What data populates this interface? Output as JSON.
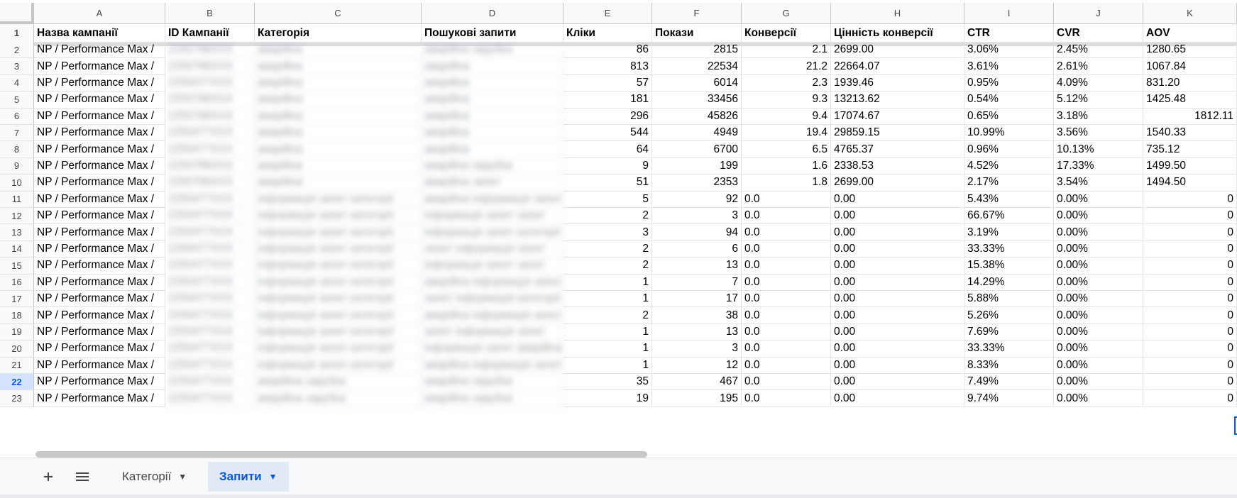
{
  "columns": [
    "",
    "A",
    "B",
    "C",
    "D",
    "E",
    "F",
    "G",
    "H",
    "I",
    "J",
    "K"
  ],
  "headers": [
    "Назва кампанії",
    "ID Кампанії",
    "Категорія",
    "Пошукові запити",
    "Кліки",
    "Покази",
    "Конверсії",
    "Цінність конверсії",
    "CTR",
    "CVR",
    "AOV"
  ],
  "rows": [
    {
      "n": "2",
      "c": [
        "NP / Performance Max /",
        "2250788XXX",
        "аварійна",
        "аварійна зарубка",
        "86",
        "2815",
        "2.1",
        "2699.00",
        "3.06%",
        "2.45%",
        "1280.65"
      ]
    },
    {
      "n": "3",
      "c": [
        "NP / Performance Max /",
        "2250788XXX",
        "аварійна",
        "аварійна",
        "813",
        "22534",
        "21.2",
        "22664.07",
        "3.61%",
        "2.61%",
        "1067.84"
      ]
    },
    {
      "n": "4",
      "c": [
        "NP / Performance Max /",
        "2250477XXX",
        "аварійна",
        "аварійна",
        "57",
        "6014",
        "2.3",
        "1939.46",
        "0.95%",
        "4.09%",
        "831.20"
      ]
    },
    {
      "n": "5",
      "c": [
        "NP / Performance Max /",
        "2250788XXX",
        "аварійна",
        "аварійна",
        "181",
        "33456",
        "9.3",
        "13213.62",
        "0.54%",
        "5.12%",
        "1425.48"
      ]
    },
    {
      "n": "6",
      "c": [
        "NP / Performance Max /",
        "2250788XXX",
        "аварійна",
        "аварійна",
        "296",
        "45826",
        "9.4",
        "17074.67",
        "0.65%",
        "3.18%",
        "1812.11"
      ]
    },
    {
      "n": "7",
      "c": [
        "NP / Performance Max /",
        "2250477XXX",
        "аварійна",
        "аварійна",
        "544",
        "4949",
        "19.4",
        "29859.15",
        "10.99%",
        "3.56%",
        "1540.33"
      ]
    },
    {
      "n": "8",
      "c": [
        "NP / Performance Max /",
        "2250477XXX",
        "аварійна",
        "аварійна",
        "64",
        "6700",
        "6.5",
        "4765.37",
        "0.96%",
        "10.13%",
        "735.12"
      ]
    },
    {
      "n": "9",
      "c": [
        "NP / Performance Max /",
        "2250788XXX",
        "аварійна",
        "аварійна зарубка",
        "9",
        "199",
        "1.6",
        "2338.53",
        "4.52%",
        "17.33%",
        "1499.50"
      ]
    },
    {
      "n": "10",
      "c": [
        "NP / Performance Max /",
        "2250788XXX",
        "аварійна",
        "аварійна запит",
        "51",
        "2353",
        "1.8",
        "2699.00",
        "2.17%",
        "3.54%",
        "1494.50"
      ]
    },
    {
      "n": "11",
      "c": [
        "NP / Performance Max /",
        "2250477XXX",
        "інформація запит категорії",
        "аварійна інформація запит",
        "5",
        "92",
        "0.0",
        "0.00",
        "5.43%",
        "0.00%",
        "0"
      ]
    },
    {
      "n": "12",
      "c": [
        "NP / Performance Max /",
        "2250477XXX",
        "інформація запит категорії",
        "інформація запит запит",
        "2",
        "3",
        "0.0",
        "0.00",
        "66.67%",
        "0.00%",
        "0"
      ]
    },
    {
      "n": "13",
      "c": [
        "NP / Performance Max /",
        "2250477XXX",
        "інформація запит категорії",
        "інформація запит категорії",
        "3",
        "94",
        "0.0",
        "0.00",
        "3.19%",
        "0.00%",
        "0"
      ]
    },
    {
      "n": "14",
      "c": [
        "NP / Performance Max /",
        "2250477XXX",
        "інформація запит категорії",
        "запит інформація запит",
        "2",
        "6",
        "0.0",
        "0.00",
        "33.33%",
        "0.00%",
        "0"
      ]
    },
    {
      "n": "15",
      "c": [
        "NP / Performance Max /",
        "2250477XXX",
        "інформація запит категорії",
        "інформація запит запит",
        "2",
        "13",
        "0.0",
        "0.00",
        "15.38%",
        "0.00%",
        "0"
      ]
    },
    {
      "n": "16",
      "c": [
        "NP / Performance Max /",
        "2250477XXX",
        "інформація запит категорії",
        "аварійна інформація запит",
        "1",
        "7",
        "0.0",
        "0.00",
        "14.29%",
        "0.00%",
        "0"
      ]
    },
    {
      "n": "17",
      "c": [
        "NP / Performance Max /",
        "2250477XXX",
        "інформація запит категорії",
        "запит інформація категорії",
        "1",
        "17",
        "0.0",
        "0.00",
        "5.88%",
        "0.00%",
        "0"
      ]
    },
    {
      "n": "18",
      "c": [
        "NP / Performance Max /",
        "2250477XXX",
        "інформація запит категорії",
        "аварійна інформація запит",
        "2",
        "38",
        "0.0",
        "0.00",
        "5.26%",
        "0.00%",
        "0"
      ]
    },
    {
      "n": "19",
      "c": [
        "NP / Performance Max /",
        "2250477XXX",
        "інформація запит категорії",
        "запит інформація запит",
        "1",
        "13",
        "0.0",
        "0.00",
        "7.69%",
        "0.00%",
        "0"
      ]
    },
    {
      "n": "20",
      "c": [
        "NP / Performance Max /",
        "2250477XXX",
        "інформація запит категорії",
        "інформація запит аварійна",
        "1",
        "3",
        "0.0",
        "0.00",
        "33.33%",
        "0.00%",
        "0"
      ]
    },
    {
      "n": "21",
      "c": [
        "NP / Performance Max /",
        "2250477XXX",
        "інформація запит категорії",
        "аварійна інформація запит",
        "1",
        "12",
        "0.0",
        "0.00",
        "8.33%",
        "0.00%",
        "0"
      ]
    },
    {
      "n": "22",
      "c": [
        "NP / Performance Max /",
        "2250477XXX",
        "аварійна зарубка",
        "аварійна зарубка",
        "35",
        "467",
        "0.0",
        "0.00",
        "7.49%",
        "0.00%",
        "0"
      ]
    },
    {
      "n": "23",
      "c": [
        "NP / Performance Max /",
        "2250477XXX",
        "аварійна зарубка",
        "аварійна зарубка",
        "19",
        "195",
        "0.0",
        "0.00",
        "9.74%",
        "0.00%",
        "0"
      ]
    }
  ],
  "selected_row": "22",
  "tabs": [
    {
      "label": "Категорії",
      "active": false
    },
    {
      "label": "Запити",
      "active": true
    }
  ],
  "icons": {
    "add_sheet": "plus-icon",
    "all_sheets": "menu-icon",
    "tab_menu": "caret-down-icon"
  },
  "colors": {
    "accent": "#0b57d0",
    "active_tab_bg": "#e1e9f7",
    "header_bg": "#f8f9fa",
    "gridline": "#e2e3e3"
  }
}
